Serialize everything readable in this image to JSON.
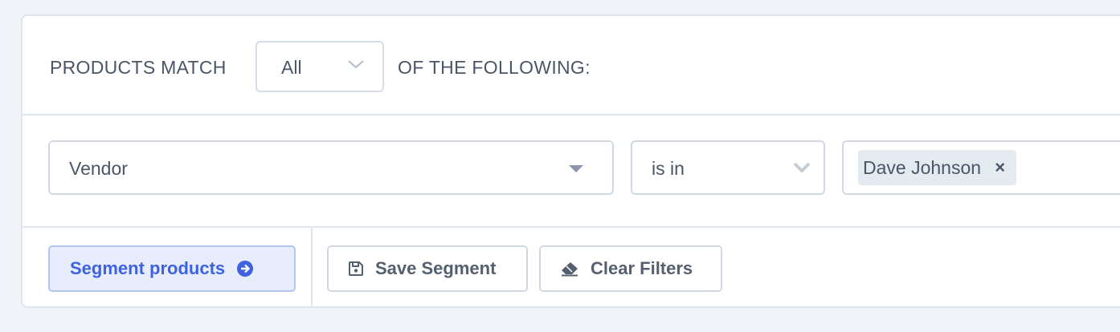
{
  "match": {
    "prefix": "PRODUCTS MATCH",
    "selected": "All",
    "suffix": "OF THE FOLLOWING:"
  },
  "filter": {
    "field": "Vendor",
    "operator": "is in",
    "values": [
      "Dave Johnson"
    ]
  },
  "actions": {
    "segment_label": "Segment products",
    "save_label": "Save Segment",
    "clear_label": "Clear Filters"
  },
  "icons": {
    "segment": "arrow-circle-right-icon",
    "save": "floppy-disk-icon",
    "clear": "eraser-icon",
    "remove_tag": "close-icon",
    "dropdown": "chevron-down-icon"
  },
  "colors": {
    "primary": "#3e63e0",
    "primary_bg": "#e7edfd",
    "border": "#d0d9e3",
    "text": "#4a5667",
    "tag_bg": "#e4ebf0"
  }
}
